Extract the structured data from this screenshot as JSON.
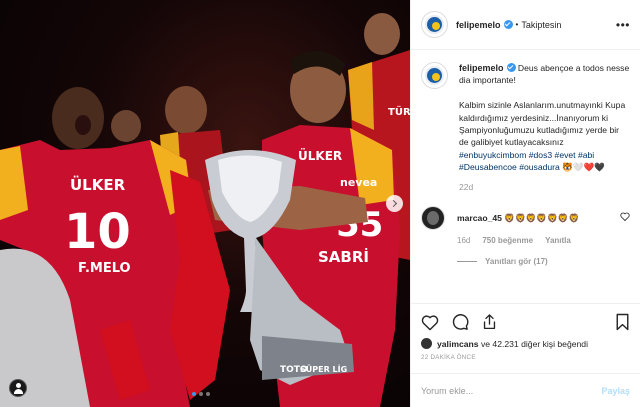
{
  "post": {
    "username": "felipemelo",
    "follow_status": "Takiptesin",
    "more_icon": "ellipsis-icon"
  },
  "photo": {
    "jersey_sponsor": "ÜLKER",
    "number_left": "10",
    "name_left": "F.MELO",
    "sponsor_right": "ÜLKER",
    "brand_right": "nevea",
    "name_right": "SABRİ",
    "number_right": "55",
    "trophy_text": "SÜPER LİG",
    "trophy_base": "TOTO",
    "bg_text": "TÜRK TELEKOM"
  },
  "caption": {
    "username": "felipemelo",
    "line1": "Deus abençoe a todos nesse dia importante!",
    "body": "Kalbim sizinle Aslanlarım.unutmayınki Kupa kaldırdığımız yerdesiniz...İnanıyorum ki Şampiyonluğumuzu kutladığımız yerde bir de galibiyet kutlayacaksınız",
    "hashtags": "#enbuyukcimbom #dos3 #evet #abi #Deusabencoe #ousadura",
    "emojis": "🐯🤍❤️🖤",
    "age": "22d"
  },
  "comment": {
    "username": "marcao_45",
    "text": "🦁🦁🦁🦁🦁🦁🦁",
    "age": "16d",
    "likes": "750 beğenme",
    "reply": "Yanıtla",
    "view_replies": "Yanıtları gör (17)"
  },
  "likes": {
    "user": "yalimcans",
    "rest": " ve 42.231 diğer kişi beğendi",
    "time": "22 DAKİKA ÖNCE"
  },
  "add_comment": {
    "placeholder": "Yorum ekle...",
    "post_label": "Paylaş"
  },
  "colors": {
    "link": "#003569",
    "verified": "#3897f0",
    "muted": "#999999",
    "jersey_red": "#c8102e",
    "jersey_yellow": "#f4b400"
  }
}
